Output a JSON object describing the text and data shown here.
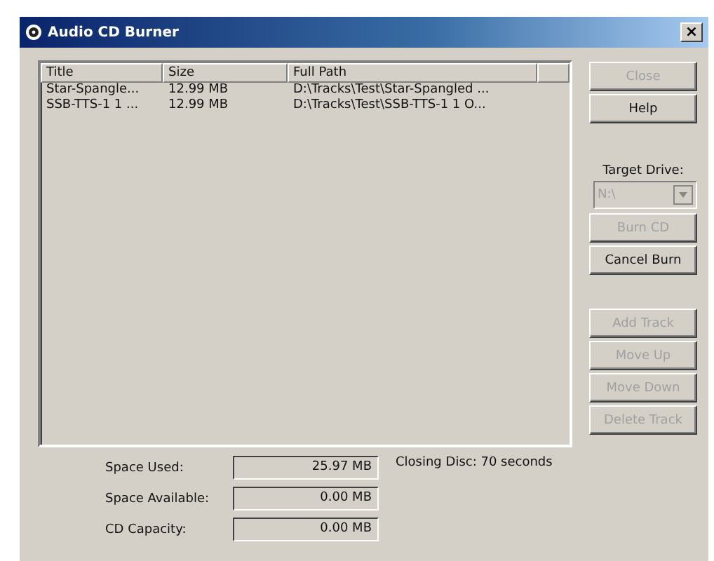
{
  "window": {
    "title": "Audio CD Burner",
    "close": "×"
  },
  "table": {
    "columns": [
      "Title",
      "Size",
      "Full Path"
    ],
    "rows": [
      {
        "title": "Star-Spangle...",
        "size": "12.99 MB",
        "path": "D:\\Tracks\\Test\\Star-Spangled ..."
      },
      {
        "title": "SSB-TTS-1 1 ...",
        "size": "12.99 MB",
        "path": "D:\\Tracks\\Test\\SSB-TTS-1 1 O..."
      }
    ]
  },
  "top_buttons": [
    {
      "label": "Close",
      "disabled": true
    },
    {
      "label": "Help",
      "disabled": false
    }
  ],
  "target_drive": {
    "label": "Target Drive:",
    "value": "N:\\",
    "disabled": true
  },
  "burn_buttons": [
    {
      "label": "Burn CD",
      "disabled": true
    },
    {
      "label": "Cancel Burn",
      "disabled": false
    }
  ],
  "track_buttons": [
    {
      "label": "Add Track",
      "disabled": true
    },
    {
      "label": "Move Up",
      "disabled": true
    },
    {
      "label": "Move Down",
      "disabled": true
    },
    {
      "label": "Delete Track",
      "disabled": true
    }
  ],
  "stats": [
    {
      "label": "Space Used:",
      "value": "25.97 MB"
    },
    {
      "label": "Space Available:",
      "value": "0.00 MB"
    },
    {
      "label": "CD Capacity:",
      "value": "0.00 MB"
    }
  ],
  "closing_disc": "Closing Disc: 70 seconds"
}
